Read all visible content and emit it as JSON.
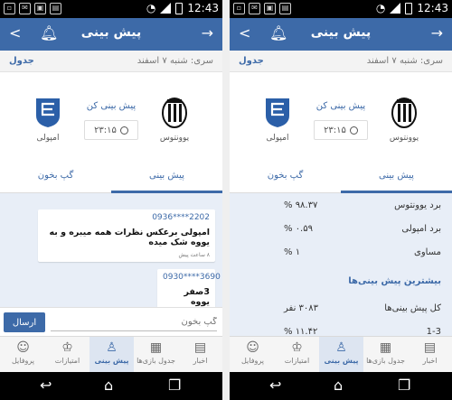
{
  "status_bar": {
    "time": "12:43"
  },
  "app_bar": {
    "title": "پیش بینی",
    "share_icon": "share-icon",
    "bell_icon": "bell-icon",
    "forward_icon": "arrow-right-icon"
  },
  "series": {
    "link": "جدول",
    "text": "سری: شنبه ۷ اسفند"
  },
  "match": {
    "home_team": "یوونتوس",
    "away_team": "امپولی",
    "predict_link": "پیش بینی کن",
    "time": "۲۳:۱۵"
  },
  "tabs": {
    "chat": "گپ بخون",
    "prediction": "پیش بینی"
  },
  "chat": {
    "messages": [
      {
        "phone": "0936****2202",
        "text": "امپولی برعکس نظرات همه میبره و به یووه شک میده",
        "time": "۸ ساعت پیش"
      },
      {
        "phone": "0930****3690",
        "text": "3صفر یووه",
        "time": ""
      }
    ],
    "input_placeholder": "گپ بخون",
    "send_label": "ارسال"
  },
  "stats": {
    "rows": [
      {
        "label": "برد یوونتوس",
        "value": "۹۸.۳۷ %"
      },
      {
        "label": "برد امپولی",
        "value": "۰.۵۹ %"
      },
      {
        "label": "مساوی",
        "value": "۱ %"
      }
    ],
    "heading": "بیشترین پیش بینی‌ها",
    "rows2": [
      {
        "label": "کل پیش بینی‌ها",
        "value": "۳۰۸۳ نفر"
      },
      {
        "label": "1-3",
        "value": "۱۱.۴۲ %"
      }
    ]
  },
  "bottom_nav": [
    {
      "label": "اخبار",
      "icon": "news-icon"
    },
    {
      "label": "جدول بازی‌ها",
      "icon": "table-icon"
    },
    {
      "label": "پیش بینی",
      "icon": "predict-icon"
    },
    {
      "label": "امتیازات",
      "icon": "trophy-icon"
    },
    {
      "label": "پروفایل",
      "icon": "profile-icon"
    }
  ],
  "colors": {
    "primary": "#3d6aa8",
    "chat_bg": "#e8eef7"
  }
}
